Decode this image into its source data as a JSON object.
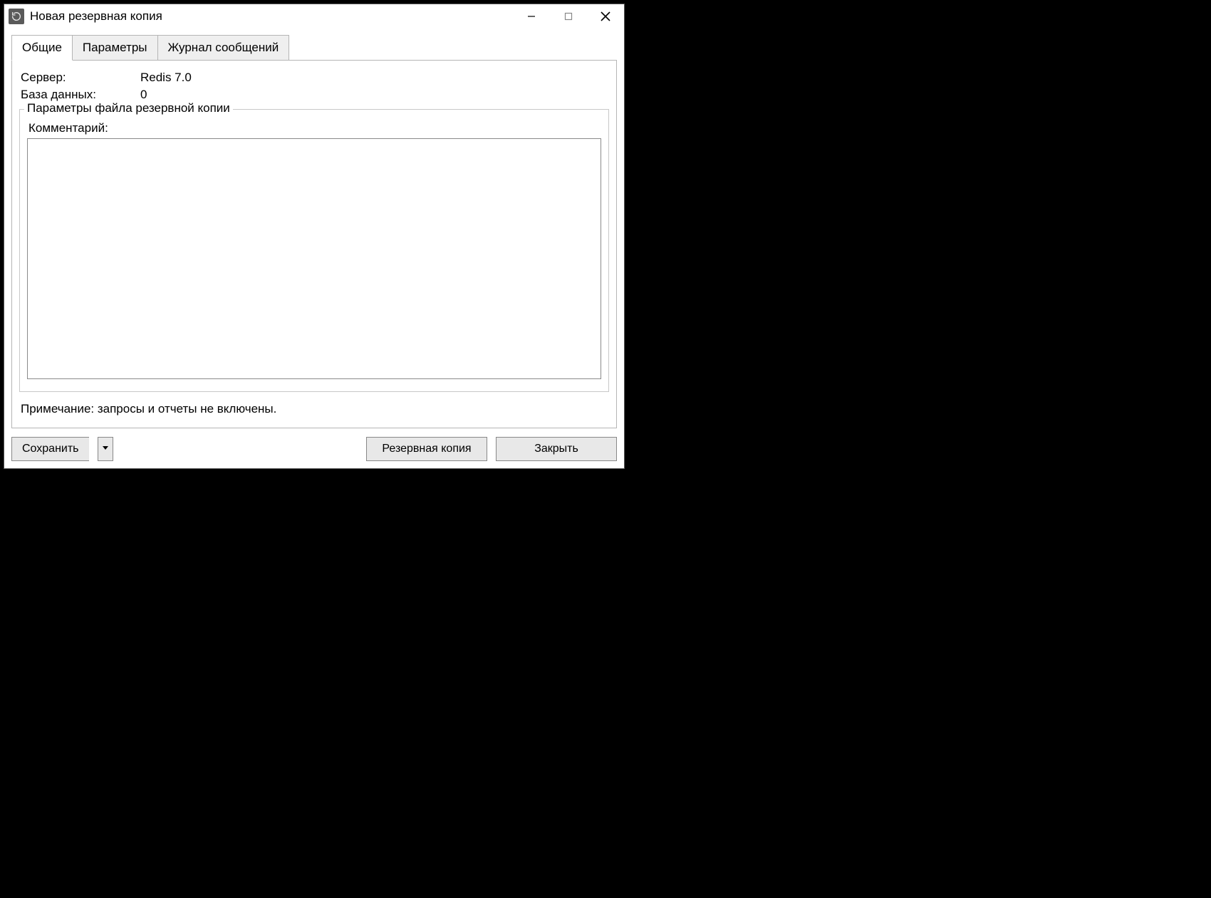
{
  "window": {
    "title": "Новая резервная копия"
  },
  "tabs": [
    {
      "label": "Общие"
    },
    {
      "label": "Параметры"
    },
    {
      "label": "Журнал сообщений"
    }
  ],
  "info": {
    "server_label": "Сервер:",
    "server_value": "Redis 7.0",
    "database_label": "База данных:",
    "database_value": "0"
  },
  "group": {
    "legend": "Параметры файла резервной копии",
    "comment_label": "Комментарий:",
    "comment_value": ""
  },
  "note": "Примечание: запросы и отчеты не включены.",
  "buttons": {
    "save": "Сохранить",
    "backup": "Резервная копия",
    "close": "Закрыть"
  }
}
